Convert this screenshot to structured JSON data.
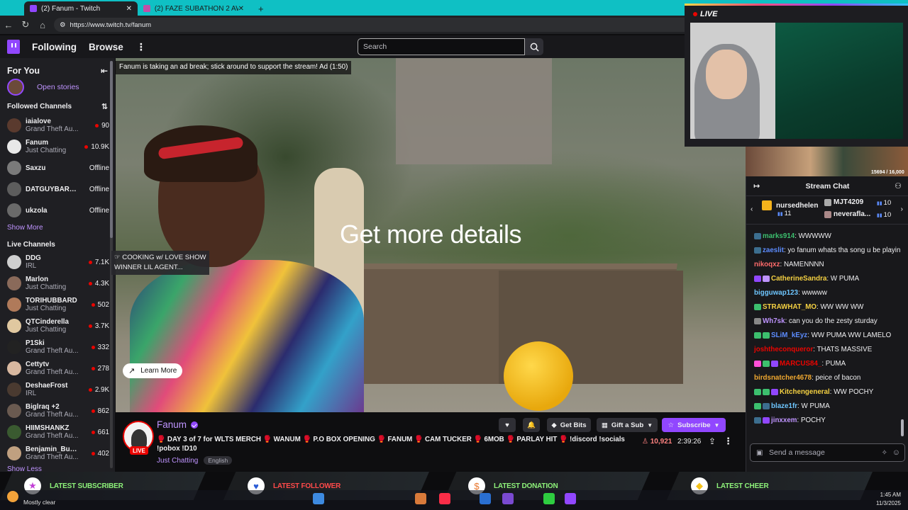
{
  "browser": {
    "tabs": [
      {
        "label": "(2) Fanum - Twitch",
        "active": true
      },
      {
        "label": "(2) FAZE SUBATHON 2 AWARDS",
        "active": false
      }
    ],
    "url": "https://www.twitch.tv/fanum"
  },
  "topnav": {
    "following": "Following",
    "browse": "Browse",
    "search_placeholder": "Search"
  },
  "sidebar": {
    "title": "For You",
    "open_stories": "Open stories",
    "followed_title": "Followed Channels",
    "followed": [
      {
        "name": "iaialove",
        "game": "Grand Theft Au...",
        "viewers": "90",
        "live": true,
        "color": "#5a3a2e"
      },
      {
        "name": "Fanum",
        "game": "Just Chatting",
        "viewers": "10.9K",
        "live": true,
        "color": "#e8e8e8"
      },
      {
        "name": "Saxzu",
        "game": "",
        "viewers": "Offline",
        "live": false,
        "color": "#7a7a7a"
      },
      {
        "name": "DATGUYBARR...",
        "game": "",
        "viewers": "Offline",
        "live": false,
        "color": "#5d5d5d"
      },
      {
        "name": "ukzola",
        "game": "",
        "viewers": "Offline",
        "live": false,
        "color": "#6a6a6a"
      }
    ],
    "show_more": "Show More",
    "live_title": "Live Channels",
    "live": [
      {
        "name": "DDG",
        "game": "IRL",
        "viewers": "7.1K",
        "color": "#cfcfcf"
      },
      {
        "name": "Marlon",
        "game": "Just Chatting",
        "viewers": "4.3K",
        "color": "#8a6a5a"
      },
      {
        "name": "TORIHUBBARD",
        "game": "Just Chatting",
        "viewers": "502",
        "color": "#b07a5a"
      },
      {
        "name": "QTCinderella",
        "game": "Just Chatting",
        "viewers": "3.7K",
        "color": "#e0c8a0"
      },
      {
        "name": "P1Ski",
        "game": "Grand Theft Au...",
        "viewers": "332",
        "color": "#222222"
      },
      {
        "name": "Cettytv",
        "game": "Grand Theft Au...",
        "viewers": "278",
        "color": "#d8b8a0"
      },
      {
        "name": "DeshaeFrost",
        "game": "IRL",
        "viewers": "2.9K",
        "color": "#4a3a30"
      },
      {
        "name": "Biglraq +2",
        "game": "Grand Theft Au...",
        "viewers": "862",
        "color": "#6a5a50"
      },
      {
        "name": "HIIMSHANKZ",
        "game": "Grand Theft Au...",
        "viewers": "661",
        "color": "#3a5a30"
      },
      {
        "name": "Benjamin_Bucks",
        "game": "Grand Theft Au...",
        "viewers": "402",
        "color": "#c0a080"
      }
    ],
    "show_less": "Show Less"
  },
  "video": {
    "ad_banner": "Fanum is taking an ad break; stick around to support the stream! Ad (1:50)",
    "headline": "Get more details",
    "learn_more": "Learn More",
    "tooltip": "☞ COOKING w/ LOVE SHOW WINNER LIL AGENT..."
  },
  "stream": {
    "name": "Fanum",
    "live_badge": "LIVE",
    "title": "🥊 DAY 3 of 7 for WLTS MERCH 🥊 WANUM 🥊 P.O BOX OPENING 🥊 FANUM 🥊 CAM TUCKER 🥊 6MOB 🥊 PARLAY HIT 🥊 !discord !socials !pobox !D10",
    "category": "Just Chatting",
    "tag": "English",
    "viewers": "10,921",
    "uptime": "2:39:26",
    "buttons": {
      "bits": "Get Bits",
      "gift": "Gift a Sub",
      "subscribe": "Subscribe"
    }
  },
  "overlay": {
    "live_label": "LIVE",
    "game_counter": "15694 / 16,000"
  },
  "chat": {
    "title": "Stream Chat",
    "gifters": [
      {
        "name": "nursedhelen",
        "count": "11"
      },
      {
        "name": "MJT4209",
        "count": "10"
      },
      {
        "name": "neverafla...",
        "count": "10"
      }
    ],
    "messages": [
      {
        "user": "marks914",
        "color": "#3cbf6e",
        "text": "WWWWW",
        "badges": [
          "#3c6e8f"
        ]
      },
      {
        "user": "zaeslit",
        "color": "#5c8cff",
        "text": "yo fanum whats tha song u be playin",
        "badges": [
          "#3c6e8f"
        ]
      },
      {
        "user": "nikoqxz",
        "color": "#ff6b6b",
        "text": "NAMENNNN",
        "badges": []
      },
      {
        "user": "CatherineSandra",
        "color": "#f5d142",
        "text": "W PUMA",
        "badges": [
          "#9147ff",
          "#bf94ff"
        ]
      },
      {
        "user": "bigguwap123",
        "color": "#6ec6ff",
        "text": "wwwww",
        "badges": []
      },
      {
        "user": "STRAWHAT_MO",
        "color": "#f5d142",
        "text": "WW WW WW",
        "badges": [
          "#3cbf6e"
        ]
      },
      {
        "user": "Wh7sk",
        "color": "#bf94ff",
        "text": "can you do the zesty sturday",
        "badges": [
          "#888888"
        ]
      },
      {
        "user": "SLiM_kEyz",
        "color": "#5c8cff",
        "text": "WW PUMA WW LAMELO",
        "badges": [
          "#3cbf6e",
          "#3cbf6e"
        ]
      },
      {
        "user": "joshtheconqueror",
        "color": "#eb0400",
        "text": "THATS MASSIVE",
        "badges": []
      },
      {
        "user": "MARCUS84_",
        "color": "#eb0400",
        "text": "PUMA",
        "badges": [
          "#ff4fd8",
          "#3cbf6e",
          "#9147ff"
        ]
      },
      {
        "user": "birdsnatcher4678",
        "color": "#f0a830",
        "text": "peice of bacon",
        "badges": []
      },
      {
        "user": "Kitchengeneral",
        "color": "#f5d142",
        "text": "WW POCHY",
        "badges": [
          "#3cbf6e",
          "#3cbf6e",
          "#9147ff"
        ]
      },
      {
        "user": "blaze1fr",
        "color": "#6ec6ff",
        "text": "W PUMA",
        "badges": [
          "#3cbf6e",
          "#3c6e8f"
        ]
      },
      {
        "user": "jinxxem",
        "color": "#bf94ff",
        "text": "POCHY",
        "badges": [
          "#3c6e8f",
          "#9147ff"
        ]
      }
    ],
    "input_placeholder": "Send a message"
  },
  "alerts": [
    {
      "label": "LATEST SUBSCRIBER",
      "icon": "★",
      "red": false
    },
    {
      "label": "LATEST FOLLOWER",
      "icon": "♥",
      "red": true
    },
    {
      "label": "LATEST DONATION",
      "icon": "$",
      "red": false
    },
    {
      "label": "LATEST CHEER",
      "icon": "◆",
      "red": false
    }
  ],
  "taskbar": {
    "weather": "Mostly clear",
    "time": "1:45 AM",
    "date": "11/3/2025"
  }
}
